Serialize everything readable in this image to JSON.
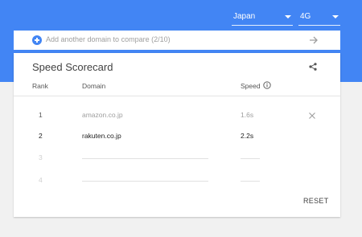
{
  "header": {
    "country": "Japan",
    "network": "4G"
  },
  "compare": {
    "text": "Add another domain to compare (2/10)"
  },
  "scorecard": {
    "title": "Speed Scorecard",
    "columns": {
      "rank": "Rank",
      "domain": "Domain",
      "speed": "Speed"
    },
    "rows": [
      {
        "rank": "1",
        "domain": "amazon.co.jp",
        "speed": "1.6s"
      },
      {
        "rank": "2",
        "domain": "rakuten.co.jp",
        "speed": "2.2s"
      },
      {
        "rank": "3",
        "domain": "",
        "speed": ""
      },
      {
        "rank": "4",
        "domain": "",
        "speed": ""
      }
    ],
    "reset_label": "RESET"
  },
  "colors": {
    "header_blue": "#4285f4",
    "background": "#f1f1f1",
    "card": "#ffffff"
  }
}
